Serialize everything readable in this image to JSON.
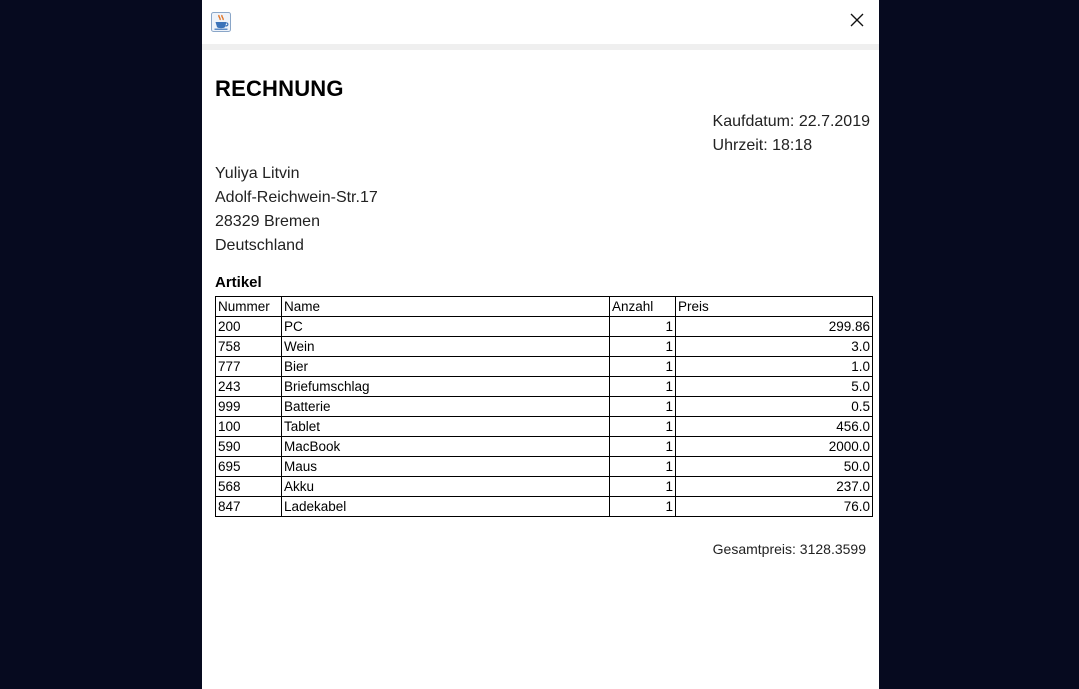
{
  "window": {
    "app_icon": "java-cup-icon",
    "close_icon": "close-icon"
  },
  "invoice": {
    "heading": "RECHNUNG",
    "purchase_date": "Kaufdatum: 22.7.2019",
    "time": "Uhrzeit: 18:18",
    "address": {
      "name": "Yuliya Litvin",
      "street": "Adolf-Reichwein-Str.17",
      "city": "28329 Bremen",
      "country": "Deutschland"
    },
    "articles_title": "Artikel",
    "columns": [
      "Nummer",
      "Name",
      "Anzahl",
      "Preis"
    ],
    "rows": [
      {
        "nummer": "200",
        "name": "PC",
        "anzahl": "1",
        "preis": "299.86"
      },
      {
        "nummer": "758",
        "name": "Wein",
        "anzahl": "1",
        "preis": "3.0"
      },
      {
        "nummer": "777",
        "name": "Bier",
        "anzahl": "1",
        "preis": "1.0"
      },
      {
        "nummer": "243",
        "name": "Briefumschlag",
        "anzahl": "1",
        "preis": "5.0"
      },
      {
        "nummer": "999",
        "name": "Batterie",
        "anzahl": "1",
        "preis": "0.5"
      },
      {
        "nummer": "100",
        "name": "Tablet",
        "anzahl": "1",
        "preis": "456.0"
      },
      {
        "nummer": "590",
        "name": "MacBook",
        "anzahl": "1",
        "preis": "2000.0"
      },
      {
        "nummer": "695",
        "name": "Maus",
        "anzahl": "1",
        "preis": "50.0"
      },
      {
        "nummer": "568",
        "name": "Akku",
        "anzahl": "1",
        "preis": "237.0"
      },
      {
        "nummer": "847",
        "name": "Ladekabel",
        "anzahl": "1",
        "preis": "76.0"
      }
    ],
    "total": "Gesamtpreis: 3128.3599"
  }
}
